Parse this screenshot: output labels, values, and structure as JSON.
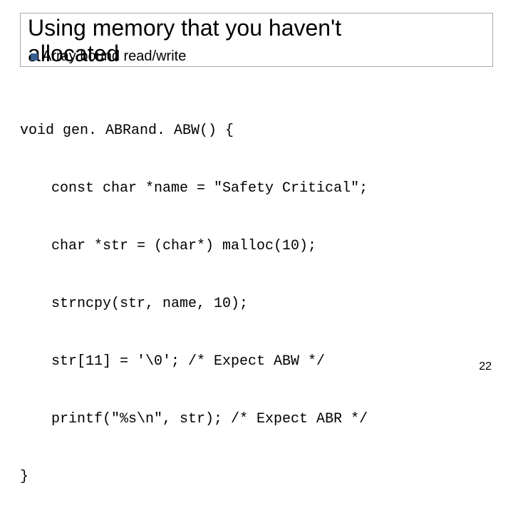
{
  "title_line1": "Using memory that you haven't",
  "title_line2": "allocated",
  "bullet_text": "Array bound read/write",
  "code": {
    "l0": "void gen. ABRand. ABW() {",
    "l1": "const char *name = \"Safety Critical\";",
    "l2": "char *str = (char*) malloc(10);",
    "l3": "strncpy(str, name, 10);",
    "l4": "str[11] = '\\0'; /* Expect ABW */",
    "l5": "printf(\"%s\\n\", str); /* Expect ABR */",
    "l6": "}"
  },
  "page_number": "22"
}
